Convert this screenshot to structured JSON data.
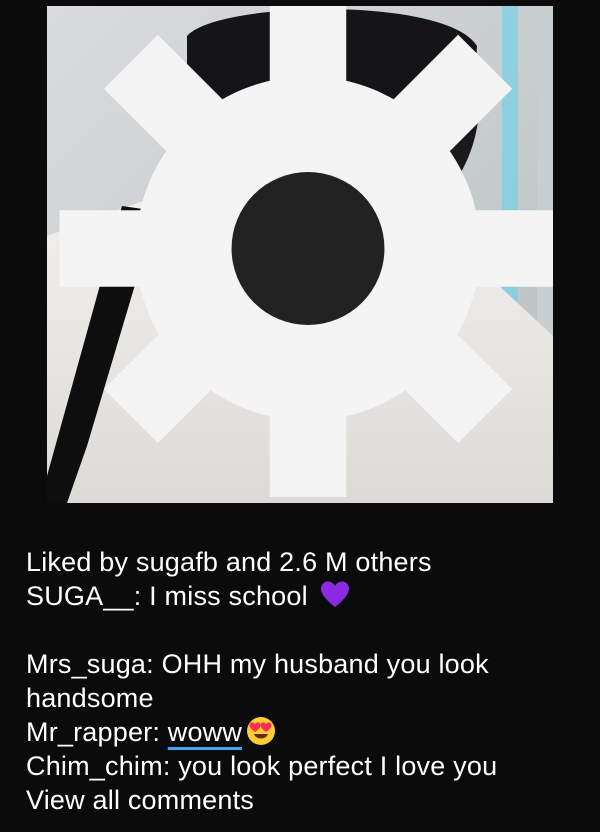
{
  "post": {
    "image_icon": "photo-of-person-in-black-mask",
    "badge_icon": "gear-icon"
  },
  "likes": {
    "text": "Liked by sugafb and 2.6 M others"
  },
  "caption": {
    "username": "SUGA__",
    "separator": ": ",
    "text": "I miss school",
    "emoji_icon": "purple-heart-icon"
  },
  "comments": [
    {
      "username": "Mrs_suga",
      "separator": ": ",
      "text": "OHH my husband you look handsome"
    },
    {
      "username": "Mr_rapper",
      "separator": ": ",
      "text": "woww",
      "emoji_icon": "heart-eyes-emoji-icon"
    },
    {
      "username": "Chim_chim",
      "separator": ": ",
      "text": "you look perfect I love you"
    }
  ],
  "view_all": {
    "label": "View all comments"
  },
  "colors": {
    "background": "#0b0b0b",
    "text": "#ffffff",
    "link_underline": "#3ea6ff",
    "purple_heart": "#8a2be2"
  }
}
